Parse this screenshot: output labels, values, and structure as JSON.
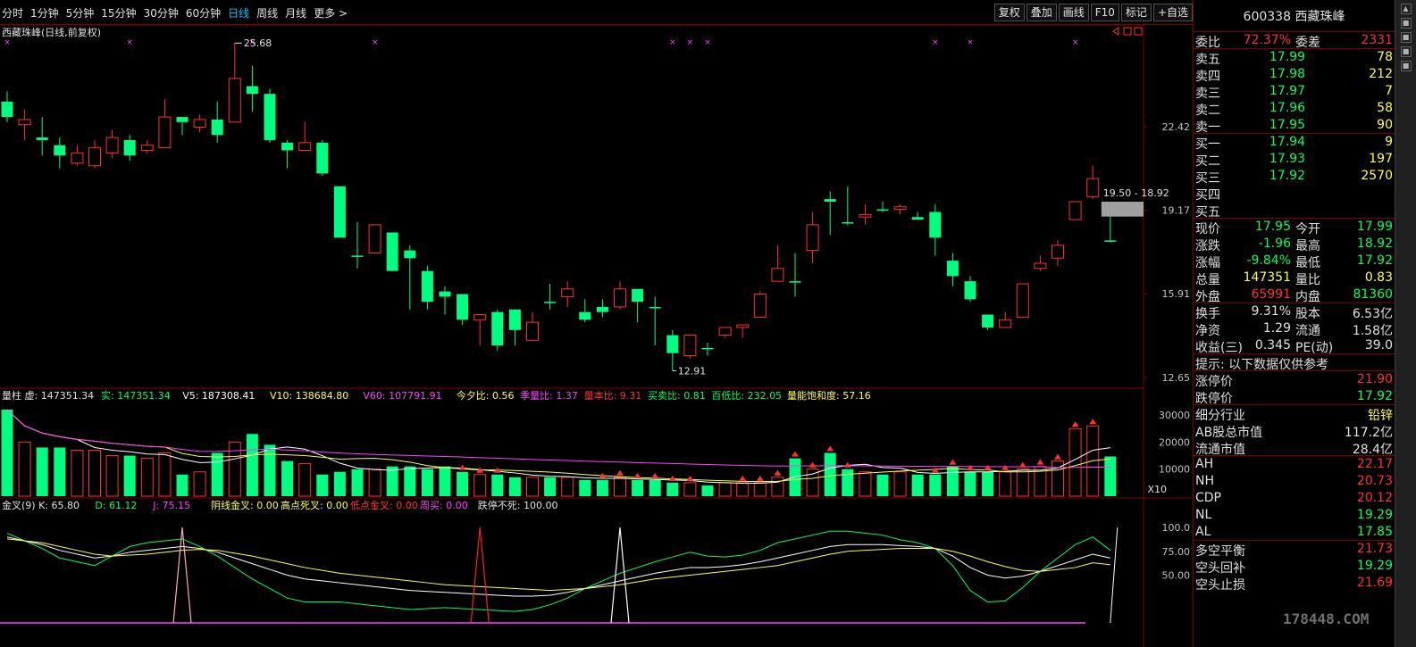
{
  "periods": [
    "分时",
    "1分钟",
    "5分钟",
    "15分钟",
    "30分钟",
    "60分钟",
    "日线",
    "周线",
    "月线",
    "更多 >"
  ],
  "active_period": "日线",
  "tools": [
    "复权",
    "叠加",
    "画线",
    "F10",
    "标记",
    "+自选"
  ],
  "chart": {
    "title": "西藏珠峰(日线,前复权)",
    "price_axis": [
      "22.42",
      "19.17",
      "15.91",
      "12.65"
    ],
    "max_label": "25.68",
    "min_label": "12.91",
    "range_label": "19.50 - 18.92",
    "vol_axis": [
      "30000",
      "20000",
      "10000"
    ],
    "vol_unit": "X10",
    "kdj_axis": [
      "100.0",
      "75.00",
      "50.00"
    ],
    "vol_header": [
      {
        "t": "量柱 虚: 147351.34",
        "c": "#e0e0e0"
      },
      {
        "t": "实: 147351.34",
        "c": "#00ff60"
      },
      {
        "t": "V5: 187308.41",
        "c": "#ffffff"
      },
      {
        "t": "V10: 138684.80",
        "c": "#ffff40"
      },
      {
        "t": "V60: 107791.91",
        "c": "#ff40ff"
      },
      {
        "t": "今夕比: 0.56",
        "c": "#ffff40"
      },
      {
        "t": "季量比: 1.37",
        "c": "#ff40ff"
      },
      {
        "t": "量本比: 9.31",
        "c": "#ff3030"
      },
      {
        "t": "买卖比: 0.81",
        "c": "#00ff60"
      },
      {
        "t": "百低比: 232.05",
        "c": "#00ff60"
      },
      {
        "t": "量能饱和度: 57.16",
        "c": "#ffff40"
      }
    ],
    "kdj_header": [
      {
        "t": "金叉(9) K: 65.80",
        "c": "#e0e0e0"
      },
      {
        "t": "D: 61.12",
        "c": "#00ff60"
      },
      {
        "t": "J: 75.15",
        "c": "#ff40ff"
      },
      {
        "t": "阴线金叉: 0.00",
        "c": "#ffff40"
      },
      {
        "t": "高点死叉: 0.00",
        "c": "#ffff40"
      },
      {
        "t": "低点金叉: 0.00",
        "c": "#ff3030"
      },
      {
        "t": "周买: 0.00",
        "c": "#ff40ff"
      },
      {
        "t": "跌停不死: 100.00",
        "c": "#e0e0e0"
      }
    ]
  },
  "side": {
    "code_name": "600338 西藏珠峰",
    "weibi": {
      "l": "委比",
      "v": "72.37%",
      "l2": "委差",
      "v2": "2331"
    },
    "sells": [
      {
        "l": "卖五",
        "p": "17.99",
        "v": "78"
      },
      {
        "l": "卖四",
        "p": "17.98",
        "v": "212"
      },
      {
        "l": "卖三",
        "p": "17.97",
        "v": "7"
      },
      {
        "l": "卖二",
        "p": "17.96",
        "v": "58"
      },
      {
        "l": "卖一",
        "p": "17.95",
        "v": "90"
      }
    ],
    "buys": [
      {
        "l": "买一",
        "p": "17.94",
        "v": "9"
      },
      {
        "l": "买二",
        "p": "17.93",
        "v": "197"
      },
      {
        "l": "买三",
        "p": "17.92",
        "v": "2570"
      },
      {
        "l": "买四",
        "p": "",
        "v": ""
      },
      {
        "l": "买五",
        "p": "",
        "v": ""
      }
    ],
    "quote": [
      {
        "l": "现价",
        "v": "17.95",
        "vc": "#00ff60",
        "l2": "今开",
        "v2": "17.99",
        "vc2": "#00ff60"
      },
      {
        "l": "涨跌",
        "v": "-1.96",
        "vc": "#00ff60",
        "l2": "最高",
        "v2": "18.92",
        "vc2": "#00ff60"
      },
      {
        "l": "涨幅",
        "v": "-9.84%",
        "vc": "#00ff60",
        "l2": "最低",
        "v2": "17.92",
        "vc2": "#00ff60"
      },
      {
        "l": "总量",
        "v": "147351",
        "vc": "#ffff40",
        "l2": "量比",
        "v2": "0.83",
        "vc2": "#ffff40"
      },
      {
        "l": "外盘",
        "v": "65991",
        "vc": "#ff3030",
        "l2": "内盘",
        "v2": "81360",
        "vc2": "#00ff60"
      }
    ],
    "fin": [
      {
        "l": "换手",
        "v": "9.31%",
        "l2": "股本",
        "v2": "6.53亿"
      },
      {
        "l": "净资",
        "v": "1.29",
        "l2": "流通",
        "v2": "1.58亿"
      },
      {
        "l": "收益(三)",
        "v": "0.345",
        "l2": "PE(动)",
        "v2": "39.0"
      }
    ],
    "tip": "提示: 以下数据仅供参考",
    "limits": [
      {
        "l": "涨停价",
        "v": "21.90",
        "c": "#ff3030"
      },
      {
        "l": "跌停价",
        "v": "17.92",
        "c": "#00ff60"
      }
    ],
    "industry": [
      {
        "l": "细分行业",
        "v": "铅锌",
        "c": "#ffff40"
      },
      {
        "l": "AB股总市值",
        "v": "117.2亿",
        "c": "#e0e0e0"
      },
      {
        "l": "流通市值",
        "v": "28.4亿",
        "c": "#e0e0e0"
      }
    ],
    "levels": [
      {
        "l": "AH",
        "v": "22.17",
        "c": "#ff3030"
      },
      {
        "l": "NH",
        "v": "20.73",
        "c": "#ff3030"
      },
      {
        "l": "CDP",
        "v": "20.12",
        "c": "#ff3030"
      },
      {
        "l": "NL",
        "v": "19.29",
        "c": "#00ff60"
      },
      {
        "l": "AL",
        "v": "17.85",
        "c": "#00ff60"
      }
    ],
    "balance": [
      {
        "l": "多空平衡",
        "v": "21.73",
        "c": "#ff3030"
      },
      {
        "l": "空头回补",
        "v": "19.29",
        "c": "#00ff60"
      },
      {
        "l": "空头止损",
        "v": "21.69",
        "c": "#ff3030"
      }
    ]
  },
  "watermark": "178448.COM",
  "candles": [
    [
      23.4,
      22.8,
      23.8,
      22.6
    ],
    [
      22.5,
      22.7,
      23.1,
      21.9
    ],
    [
      22.0,
      21.9,
      22.8,
      21.3
    ],
    [
      21.7,
      21.3,
      22.0,
      20.8
    ],
    [
      21.0,
      21.4,
      21.7,
      20.9
    ],
    [
      20.9,
      21.6,
      21.9,
      20.8
    ],
    [
      21.4,
      22.0,
      22.3,
      21.2
    ],
    [
      21.9,
      21.3,
      22.1,
      21.1
    ],
    [
      21.5,
      21.7,
      21.9,
      21.4
    ],
    [
      21.6,
      22.8,
      23.5,
      21.6
    ],
    [
      22.8,
      22.6,
      22.8,
      22.1
    ],
    [
      22.4,
      22.7,
      22.9,
      22.2
    ],
    [
      22.7,
      22.1,
      23.4,
      21.8
    ],
    [
      22.6,
      24.3,
      25.68,
      22.6
    ],
    [
      24.0,
      23.7,
      24.8,
      23.0
    ],
    [
      23.7,
      21.9,
      23.9,
      21.8
    ],
    [
      21.8,
      21.5,
      21.9,
      20.8
    ],
    [
      21.5,
      21.8,
      22.6,
      21.5
    ],
    [
      21.8,
      20.6,
      21.9,
      20.5
    ],
    [
      20.1,
      18.1,
      20.1,
      18.1
    ],
    [
      17.4,
      17.4,
      18.7,
      16.9
    ],
    [
      17.5,
      18.6,
      18.6,
      17.5
    ],
    [
      18.3,
      16.8,
      18.3,
      16.8
    ],
    [
      17.6,
      17.3,
      17.8,
      15.3
    ],
    [
      16.8,
      15.6,
      17.0,
      15.3
    ],
    [
      16.0,
      15.8,
      16.2,
      15.1
    ],
    [
      15.9,
      14.9,
      15.9,
      14.7
    ],
    [
      14.9,
      15.1,
      15.1,
      13.9
    ],
    [
      15.2,
      13.9,
      15.3,
      13.7
    ],
    [
      15.3,
      14.5,
      15.3,
      13.9
    ],
    [
      14.1,
      14.8,
      15.2,
      14.1
    ],
    [
      15.6,
      15.6,
      16.3,
      15.3
    ],
    [
      15.8,
      16.1,
      16.4,
      15.4
    ],
    [
      15.2,
      14.9,
      15.7,
      14.8
    ],
    [
      15.4,
      15.2,
      15.7,
      15.0
    ],
    [
      15.4,
      16.1,
      16.4,
      15.3
    ],
    [
      16.1,
      15.6,
      16.1,
      14.8
    ],
    [
      15.4,
      15.4,
      15.8,
      13.9
    ],
    [
      14.3,
      13.6,
      14.5,
      12.91
    ],
    [
      13.5,
      14.3,
      14.3,
      13.4
    ],
    [
      13.8,
      13.8,
      14.0,
      13.5
    ],
    [
      14.3,
      14.6,
      14.6,
      14.2
    ],
    [
      14.6,
      14.7,
      14.7,
      14.2
    ],
    [
      15.0,
      15.9,
      16.0,
      15.0
    ],
    [
      16.4,
      16.9,
      17.8,
      16.4
    ],
    [
      16.4,
      16.4,
      17.5,
      15.8
    ],
    [
      17.6,
      18.6,
      19.1,
      17.1
    ],
    [
      19.6,
      19.5,
      19.9,
      18.2
    ],
    [
      18.7,
      18.7,
      20.1,
      18.6
    ],
    [
      18.9,
      19.0,
      19.4,
      18.6
    ],
    [
      19.2,
      19.2,
      19.5,
      19.1
    ],
    [
      19.2,
      19.3,
      19.4,
      19.0
    ],
    [
      18.9,
      18.8,
      19.1,
      18.8
    ],
    [
      19.1,
      18.1,
      19.4,
      17.4
    ],
    [
      17.2,
      16.6,
      17.5,
      16.2
    ],
    [
      16.4,
      15.7,
      16.6,
      15.6
    ],
    [
      15.1,
      14.6,
      15.1,
      14.5
    ],
    [
      14.6,
      14.9,
      15.2,
      14.6
    ],
    [
      15.0,
      16.3,
      16.3,
      15.0
    ],
    [
      16.9,
      17.1,
      17.4,
      16.8
    ],
    [
      17.3,
      17.8,
      18.0,
      17.0
    ],
    [
      18.8,
      19.5,
      19.5,
      18.8
    ],
    [
      19.7,
      20.4,
      20.9,
      19.6
    ],
    [
      17.99,
      17.95,
      18.92,
      17.92
    ]
  ],
  "volumes": [
    32000,
    20000,
    18000,
    18000,
    17000,
    17000,
    15000,
    15000,
    14000,
    16000,
    8000,
    9000,
    16000,
    20000,
    23000,
    19000,
    13000,
    12000,
    8000,
    9000,
    10000,
    10000,
    11000,
    11000,
    10000,
    11000,
    9000,
    8000,
    8000,
    7000,
    7000,
    7000,
    7000,
    6000,
    6000,
    7000,
    6000,
    6000,
    5000,
    5000,
    4000,
    5000,
    5000,
    5000,
    7000,
    14000,
    10000,
    16000,
    10000,
    9000,
    8000,
    9000,
    8000,
    8000,
    11000,
    9000,
    9000,
    9000,
    10000,
    11000,
    13000,
    25000,
    26000,
    14700
  ],
  "kdj": {
    "K": [
      90,
      86,
      82,
      76,
      72,
      68,
      70,
      74,
      76,
      78,
      80,
      78,
      74,
      68,
      62,
      56,
      50,
      46,
      44,
      42,
      40,
      38,
      36,
      34,
      33,
      32,
      31,
      30,
      29,
      28,
      28,
      29,
      32,
      36,
      40,
      44,
      48,
      52,
      55,
      58,
      58,
      59,
      61,
      64,
      68,
      72,
      76,
      80,
      82,
      82,
      82,
      81,
      80,
      78,
      70,
      58,
      50,
      47,
      49,
      54,
      60,
      66,
      72,
      68
    ],
    "D": [
      88,
      86,
      84,
      80,
      76,
      72,
      70,
      71,
      72,
      74,
      76,
      77,
      76,
      73,
      70,
      66,
      62,
      58,
      55,
      52,
      50,
      48,
      46,
      44,
      42,
      40,
      39,
      38,
      37,
      36,
      35,
      34,
      35,
      36,
      38,
      40,
      43,
      46,
      48,
      50,
      52,
      54,
      56,
      58,
      60,
      64,
      68,
      72,
      75,
      76,
      77,
      78,
      78,
      78,
      75,
      70,
      64,
      59,
      55,
      54,
      56,
      58,
      63,
      61
    ],
    "J": [
      94,
      86,
      78,
      68,
      64,
      60,
      70,
      80,
      84,
      86,
      88,
      80,
      70,
      58,
      46,
      36,
      26,
      22,
      22,
      22,
      20,
      18,
      16,
      14,
      15,
      16,
      15,
      14,
      13,
      12,
      14,
      19,
      26,
      36,
      44,
      52,
      58,
      64,
      69,
      74,
      70,
      69,
      71,
      76,
      84,
      88,
      92,
      96,
      96,
      94,
      92,
      87,
      84,
      78,
      60,
      34,
      22,
      23,
      37,
      54,
      68,
      82,
      90,
      76
    ],
    "signals": [
      {
        "i": 10,
        "c": "#ffb0b0"
      },
      {
        "i": 27,
        "c": "#ff2020"
      },
      {
        "i": 35,
        "c": "#ffffff"
      }
    ]
  },
  "marks": {
    "x_top": [
      0,
      7,
      14,
      21,
      38,
      39,
      40,
      53,
      55,
      61
    ],
    "red_ups": [
      26,
      27,
      28,
      34,
      35,
      36,
      37,
      38,
      39,
      42,
      43,
      44,
      45,
      46,
      47,
      48,
      53,
      54,
      55,
      56,
      57,
      58,
      59,
      60,
      61,
      62
    ]
  }
}
